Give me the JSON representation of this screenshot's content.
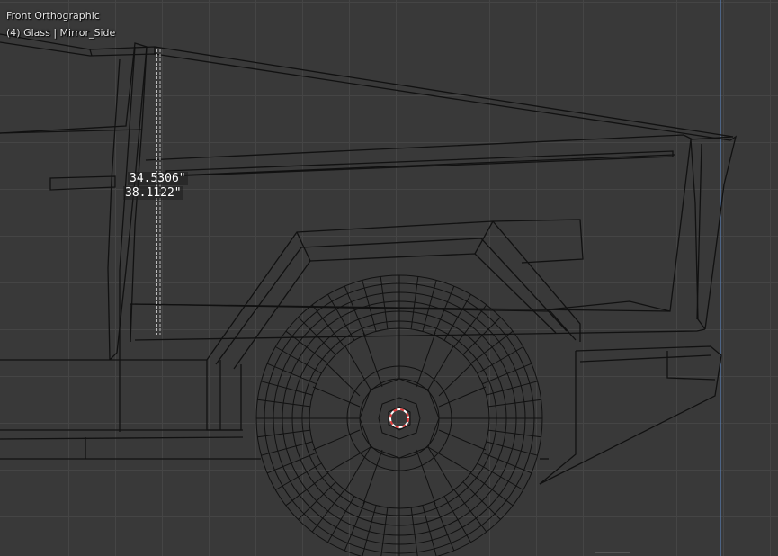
{
  "viewport": {
    "view_name": "Front Orthographic",
    "object_info": "(4) Glass | Mirror_Side",
    "colors": {
      "background": "#393939",
      "grid": "#454545",
      "wire": "#111111",
      "axis": "#5b82b8",
      "cursor_red": "#e03a3a"
    }
  },
  "measurements": [
    {
      "value": "34.5306\""
    },
    {
      "value": "38.1122\""
    }
  ]
}
